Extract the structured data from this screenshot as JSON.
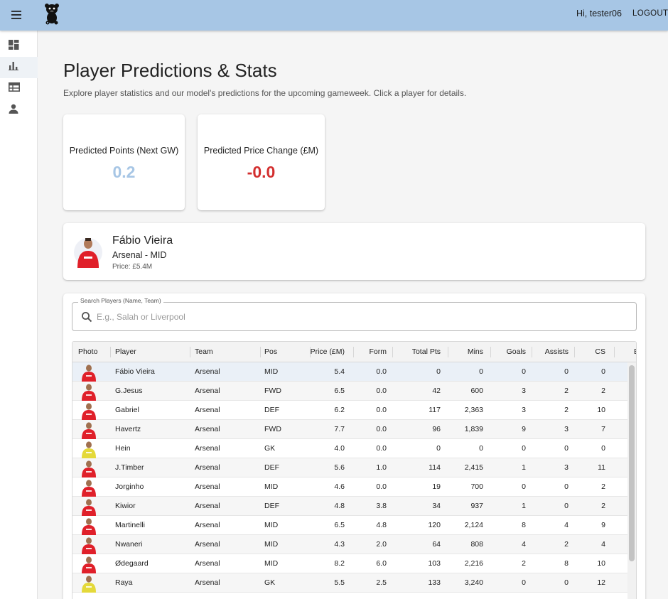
{
  "appbar": {
    "greeting": "Hi, tester06",
    "logout_label": "LOGOUT"
  },
  "sidebar": {
    "items": [
      {
        "icon": "dashboard-icon"
      },
      {
        "icon": "bar-chart-icon"
      },
      {
        "icon": "table-icon"
      },
      {
        "icon": "person-icon"
      }
    ]
  },
  "page": {
    "title": "Player Predictions & Stats",
    "subtitle": "Explore player statistics and our model's predictions for the upcoming gameweek. Click a player for details."
  },
  "stats": {
    "points_label": "Predicted Points (Next GW)",
    "points_value": "0.2",
    "points_color": "#a7c6e5",
    "price_label": "Predicted Price Change (£M)",
    "price_value": "-0.0",
    "price_color": "#d32f2f"
  },
  "selected_player": {
    "name": "Fábio Vieira",
    "team_pos": "Arsenal - MID",
    "price": "Price: £5.4M"
  },
  "search": {
    "label": "Search Players (Name, Team)",
    "placeholder": "E.g., Salah or Liverpool",
    "value": ""
  },
  "table": {
    "columns": [
      "Photo",
      "Player",
      "Team",
      "Pos",
      "Price (£M)",
      "Form",
      "Total Pts",
      "Mins",
      "Goals",
      "Assists",
      "CS",
      "B"
    ],
    "rows": [
      {
        "player": "Fábio Vieira",
        "team": "Arsenal",
        "pos": "MID",
        "price": "5.4",
        "form": "0.0",
        "pts": "0",
        "mins": "0",
        "goals": "0",
        "assists": "0",
        "cs": "0",
        "kit": "outfield"
      },
      {
        "player": "G.Jesus",
        "team": "Arsenal",
        "pos": "FWD",
        "price": "6.5",
        "form": "0.0",
        "pts": "42",
        "mins": "600",
        "goals": "3",
        "assists": "2",
        "cs": "2",
        "kit": "outfield"
      },
      {
        "player": "Gabriel",
        "team": "Arsenal",
        "pos": "DEF",
        "price": "6.2",
        "form": "0.0",
        "pts": "117",
        "mins": "2,363",
        "goals": "3",
        "assists": "2",
        "cs": "10",
        "kit": "outfield"
      },
      {
        "player": "Havertz",
        "team": "Arsenal",
        "pos": "FWD",
        "price": "7.7",
        "form": "0.0",
        "pts": "96",
        "mins": "1,839",
        "goals": "9",
        "assists": "3",
        "cs": "7",
        "kit": "outfield"
      },
      {
        "player": "Hein",
        "team": "Arsenal",
        "pos": "GK",
        "price": "4.0",
        "form": "0.0",
        "pts": "0",
        "mins": "0",
        "goals": "0",
        "assists": "0",
        "cs": "0",
        "kit": "gk"
      },
      {
        "player": "J.Timber",
        "team": "Arsenal",
        "pos": "DEF",
        "price": "5.6",
        "form": "1.0",
        "pts": "114",
        "mins": "2,415",
        "goals": "1",
        "assists": "3",
        "cs": "11",
        "kit": "outfield"
      },
      {
        "player": "Jorginho",
        "team": "Arsenal",
        "pos": "MID",
        "price": "4.6",
        "form": "0.0",
        "pts": "19",
        "mins": "700",
        "goals": "0",
        "assists": "0",
        "cs": "2",
        "kit": "outfield"
      },
      {
        "player": "Kiwior",
        "team": "Arsenal",
        "pos": "DEF",
        "price": "4.8",
        "form": "3.8",
        "pts": "34",
        "mins": "937",
        "goals": "1",
        "assists": "0",
        "cs": "2",
        "kit": "outfield"
      },
      {
        "player": "Martinelli",
        "team": "Arsenal",
        "pos": "MID",
        "price": "6.5",
        "form": "4.8",
        "pts": "120",
        "mins": "2,124",
        "goals": "8",
        "assists": "4",
        "cs": "9",
        "kit": "outfield"
      },
      {
        "player": "Nwaneri",
        "team": "Arsenal",
        "pos": "MID",
        "price": "4.3",
        "form": "2.0",
        "pts": "64",
        "mins": "808",
        "goals": "4",
        "assists": "2",
        "cs": "4",
        "kit": "outfield"
      },
      {
        "player": "Ødegaard",
        "team": "Arsenal",
        "pos": "MID",
        "price": "8.2",
        "form": "6.0",
        "pts": "103",
        "mins": "2,216",
        "goals": "2",
        "assists": "8",
        "cs": "10",
        "kit": "outfield"
      },
      {
        "player": "Raya",
        "team": "Arsenal",
        "pos": "GK",
        "price": "5.5",
        "form": "2.5",
        "pts": "133",
        "mins": "3,240",
        "goals": "0",
        "assists": "0",
        "cs": "12",
        "kit": "gk"
      }
    ]
  },
  "colors": {
    "appbar": "#a7c6e5",
    "kit_red": "#e0202a",
    "kit_gk": "#e4d93a"
  }
}
